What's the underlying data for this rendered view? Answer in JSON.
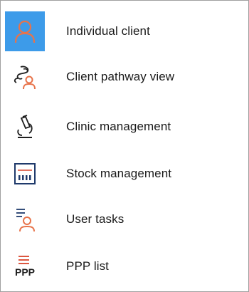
{
  "menu": {
    "items": [
      {
        "label": "Individual client",
        "icon": "person-icon",
        "selected": true
      },
      {
        "label": "Client pathway view",
        "icon": "pathway-person-icon",
        "selected": false
      },
      {
        "label": "Clinic management",
        "icon": "microscope-icon",
        "selected": false
      },
      {
        "label": "Stock management",
        "icon": "stock-chart-icon",
        "selected": false
      },
      {
        "label": "User tasks",
        "icon": "task-list-person-icon",
        "selected": false
      },
      {
        "label": "PPP list",
        "icon": "ppp-list-icon",
        "ppp_text": "PPP",
        "selected": false
      }
    ]
  },
  "colors": {
    "selection": "#3d9be9",
    "accent_orange": "#e8734a",
    "icon_dark": "#1f1f1f",
    "stock_red": "#d9432b",
    "stock_navy": "#1f3a6b"
  }
}
